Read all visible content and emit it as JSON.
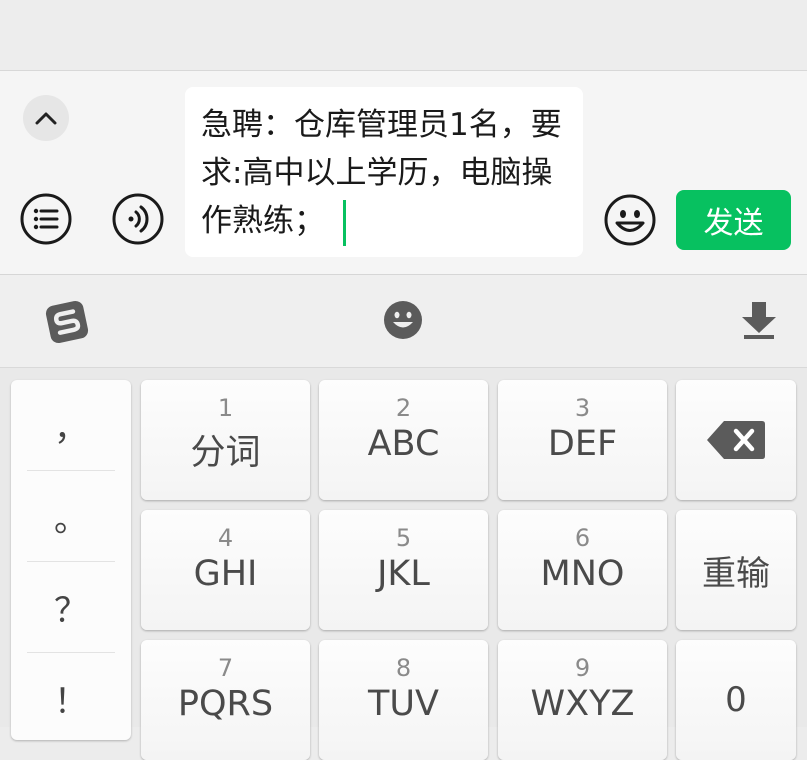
{
  "chat": {
    "message_text": "急聘：仓库管理员1名，要求:高中以上学历，电脑操作熟练；",
    "send_label": "发送",
    "accent_color": "#07c160"
  },
  "toolbar": {
    "icons": [
      "sogou-logo-icon",
      "emoji-icon",
      "hide-keyboard-icon"
    ]
  },
  "keyboard": {
    "punctuation": [
      "，",
      "。",
      "？",
      "！"
    ],
    "keys": [
      {
        "num": "1",
        "label": "分词"
      },
      {
        "num": "2",
        "label": "ABC"
      },
      {
        "num": "3",
        "label": "DEF"
      },
      {
        "num": "4",
        "label": "GHI"
      },
      {
        "num": "5",
        "label": "JKL"
      },
      {
        "num": "6",
        "label": "MNO"
      },
      {
        "num": "7",
        "label": "PQRS"
      },
      {
        "num": "8",
        "label": "TUV"
      },
      {
        "num": "9",
        "label": "WXYZ"
      }
    ],
    "retype_label": "重输",
    "zero_label": "0"
  }
}
